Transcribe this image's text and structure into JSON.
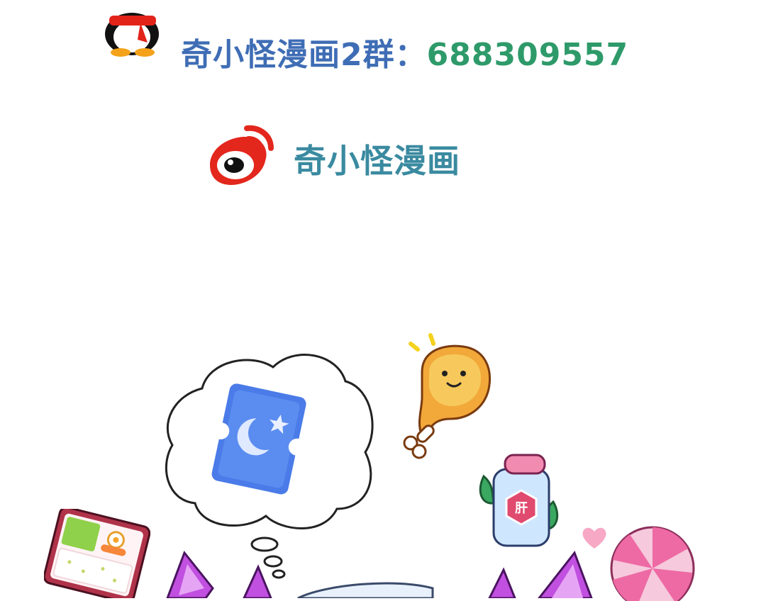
{
  "promo": {
    "qq_group_label": "奇小怪漫画2群：",
    "qq_group_number": "688309557",
    "weibo_name": "奇小怪漫画"
  },
  "colors": {
    "qq_text": "#3f6db5",
    "qq_number": "#2e9a6a",
    "weibo_text": "#3a8aa0",
    "weibo_red": "#e3271d"
  },
  "icons": [
    "qq-penguin-icon",
    "weibo-icon",
    "moon-ticket-icon",
    "chicken-drumstick-icon",
    "potion-bottle-icon",
    "bento-box-icon",
    "candy-icon",
    "heart-icon"
  ],
  "stickers": {
    "bottle_label": "肝"
  }
}
